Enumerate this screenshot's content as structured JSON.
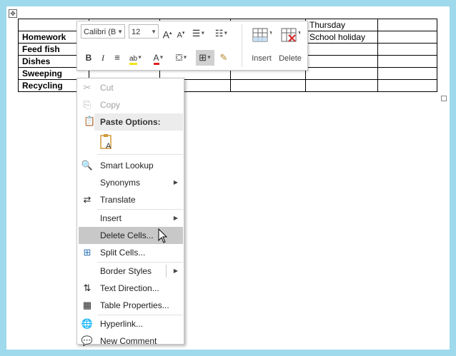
{
  "table": {
    "rows": [
      [
        "",
        "",
        "",
        "",
        "Thursday",
        ""
      ],
      [
        "Homework",
        "",
        "",
        "",
        "School holiday",
        ""
      ],
      [
        "Feed fish",
        "",
        "",
        "",
        "",
        ""
      ],
      [
        "Dishes",
        "",
        "",
        "",
        "",
        ""
      ],
      [
        "Sweeping",
        "",
        "",
        "",
        "",
        ""
      ],
      [
        "Recycling",
        "",
        "",
        "",
        "",
        ""
      ]
    ]
  },
  "mini_toolbar": {
    "font_name": "Calibri (B",
    "font_size": "12",
    "insert_label": "Insert",
    "delete_label": "Delete"
  },
  "context_menu": {
    "items": {
      "cut": "Cut",
      "copy": "Copy",
      "paste_options": "Paste Options:",
      "smart_lookup": "Smart Lookup",
      "synonyms": "Synonyms",
      "translate": "Translate",
      "insert": "Insert",
      "delete_cells": "Delete Cells...",
      "split_cells": "Split Cells...",
      "border_styles": "Border Styles",
      "text_direction": "Text Direction...",
      "table_properties": "Table Properties...",
      "hyperlink": "Hyperlink...",
      "new_comment": "New Comment"
    }
  },
  "colors": {
    "desktop_bg": "#9fd9ec",
    "highlight": "#c8c8c8",
    "font_color_red": "#e02020",
    "highlight_yellow": "#f5e21a"
  }
}
